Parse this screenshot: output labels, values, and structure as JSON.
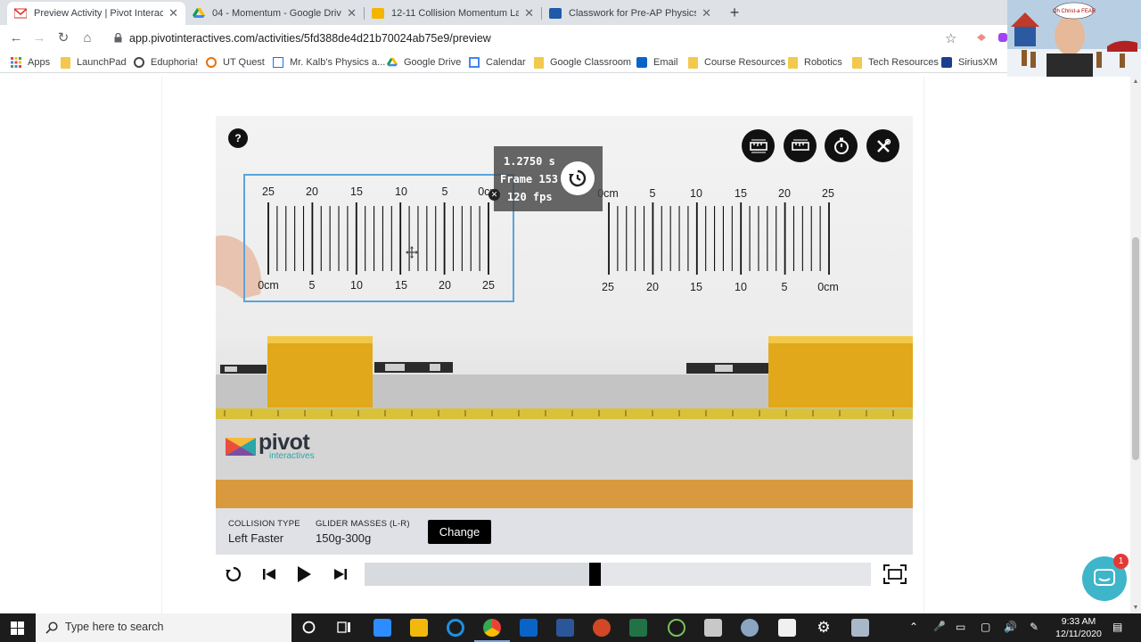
{
  "browser": {
    "tabs": [
      {
        "title": "Preview Activity | Pivot Interactiv",
        "active": true
      },
      {
        "title": "04 - Momentum - Google Drive",
        "active": false
      },
      {
        "title": "12-11 Collision Momentum Lab",
        "active": false
      },
      {
        "title": "Classwork for Pre-AP Physics - 2",
        "active": false
      }
    ],
    "url": "app.pivotinteractives.com/activities/5fd388de4d21b70024ab75e9/preview",
    "bookmarks": [
      {
        "label": "Apps"
      },
      {
        "label": "LaunchPad"
      },
      {
        "label": "Eduphoria!"
      },
      {
        "label": "UT Quest"
      },
      {
        "label": "Mr. Kalb's Physics a..."
      },
      {
        "label": "Google Drive"
      },
      {
        "label": "Calendar"
      },
      {
        "label": "Google Classroom"
      },
      {
        "label": "Email"
      },
      {
        "label": "Course Resources"
      },
      {
        "label": "Robotics"
      },
      {
        "label": "Tech Resources"
      },
      {
        "label": "SiriusXM"
      }
    ]
  },
  "webcam": {
    "bubble_text": "Oh Christ-a FEAR"
  },
  "video": {
    "help_label": "?",
    "frame_info": {
      "time": "1.2750 s",
      "frame": "Frame 153",
      "fps": "120 fps"
    },
    "ruler_left": {
      "top_labels": [
        "25",
        "20",
        "15",
        "10",
        "5",
        "0cm"
      ],
      "bottom_labels": [
        "0cm",
        "5",
        "10",
        "15",
        "20",
        "25"
      ]
    },
    "ruler_right": {
      "top_labels": [
        "0cm",
        "5",
        "10",
        "15",
        "20",
        "25"
      ],
      "bottom_labels": [
        "25",
        "20",
        "15",
        "10",
        "5",
        "0cm"
      ]
    },
    "logo": {
      "name": "pivot",
      "sub": "interactives"
    }
  },
  "info": {
    "collision_caption": "COLLISION TYPE",
    "collision_value": "Left Faster",
    "mass_caption": "GLIDER MASSES (L-R)",
    "mass_value": "150g-300g",
    "change_label": "Change"
  },
  "playback": {
    "progress": 0.455
  },
  "chat": {
    "badge": "1"
  },
  "taskbar": {
    "search_placeholder": "Type here to search",
    "time": "9:33 AM",
    "date": "12/11/2020"
  }
}
